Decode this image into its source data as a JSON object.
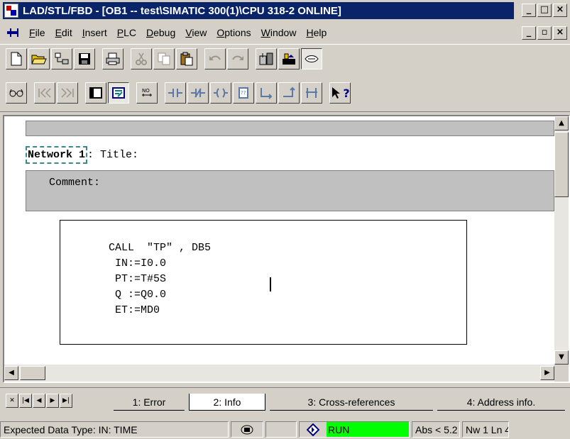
{
  "window": {
    "title": "LAD/STL/FBD  - [OB1 -- test\\SIMATIC 300(1)\\CPU 318-2  ONLINE]",
    "minimize": "_",
    "maximize": "□",
    "close": "×",
    "restore": "▫"
  },
  "menu": {
    "items": [
      {
        "u": "F",
        "rest": "ile"
      },
      {
        "u": "E",
        "rest": "dit"
      },
      {
        "u": "I",
        "rest": "nsert"
      },
      {
        "u": "P",
        "rest": "LC"
      },
      {
        "u": "D",
        "rest": "ebug"
      },
      {
        "u": "V",
        "rest": "iew"
      },
      {
        "u": "O",
        "rest": "ptions"
      },
      {
        "u": "W",
        "rest": "indow"
      },
      {
        "u": "H",
        "rest": "elp"
      }
    ]
  },
  "toolbar": {
    "row1": [
      "new-icon",
      "open-icon",
      "accessible-nodes-icon",
      "save-icon",
      "print-icon",
      "cut-icon",
      "copy-icon",
      "paste-icon",
      "undo-icon",
      "redo-icon",
      "download-icon",
      "upload-icon",
      "monitor-icon"
    ],
    "row2": [
      "glasses-icon",
      "previous-network-icon",
      "next-network-icon",
      "overview-icon",
      "program-elements-icon",
      "new-network-icon",
      "contact-no-icon",
      "contact-nc-icon",
      "coil-icon",
      "empty-box-icon",
      "branch-open-icon",
      "branch-close-icon",
      "branch-icon",
      "help-cursor-icon"
    ],
    "help_label": "?"
  },
  "editor": {
    "network_label": "Network 1",
    "network_title": ": Title:",
    "comment_label": "Comment:",
    "code": [
      "CALL  \"TP\" , DB5",
      " IN:=I0.0",
      " PT:=T#5S",
      " Q :=Q0.0",
      " ET:=MD0"
    ]
  },
  "tabs": [
    {
      "label": "1: Error",
      "active": false
    },
    {
      "label": "2: Info",
      "active": true
    },
    {
      "label": "3: Cross-references",
      "active": false
    },
    {
      "label": "4: Address info.",
      "active": false
    }
  ],
  "status": {
    "message": "Expected Data Type: IN: TIME",
    "run": "RUN",
    "run_color": "#00ff00",
    "abs": "Abs < 5.2",
    "nw": "Nw 1  Ln 4"
  }
}
